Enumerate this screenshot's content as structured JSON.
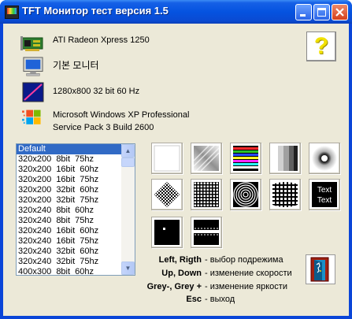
{
  "window": {
    "title": "TFT Монитор тест версия 1.5"
  },
  "info": {
    "video": "ATI Radeon Xpress 1250",
    "monitor": "기본 모니터",
    "mode": "1280x800 32 bit 60 Hz",
    "os_line1": "Microsoft Windows XP Professional",
    "os_line2": "Service Pack 3 Build 2600"
  },
  "help": {
    "label": "?"
  },
  "modes": [
    "Default",
    "320x200  8bit  75hz",
    "320x200  16bit  60hz",
    "320x200  16bit  75hz",
    "320x200  32bit  60hz",
    "320x200  32bit  75hz",
    "320x240  8bit  60hz",
    "320x240  8bit  75hz",
    "320x240  16bit  60hz",
    "320x240  16bit  75hz",
    "320x240  32bit  60hz",
    "320x240  32bit  75hz",
    "400x300  8bit  60hz"
  ],
  "selected_mode": "Default",
  "tests": {
    "text_label_1": "Text",
    "text_label_2": "Text"
  },
  "shortcuts": [
    {
      "key": "Left, Rigth",
      "desc": "- выбор подрежима"
    },
    {
      "key": "Up, Down",
      "desc": "- изменение скорости"
    },
    {
      "key": "Grey-, Grey +",
      "desc": "- изменение яркости"
    },
    {
      "key": "Esc",
      "desc": "- выход"
    }
  ],
  "colors": {
    "titlebar": "#0553e0",
    "selection": "#316ac5",
    "help_mark": "#f2e200"
  }
}
